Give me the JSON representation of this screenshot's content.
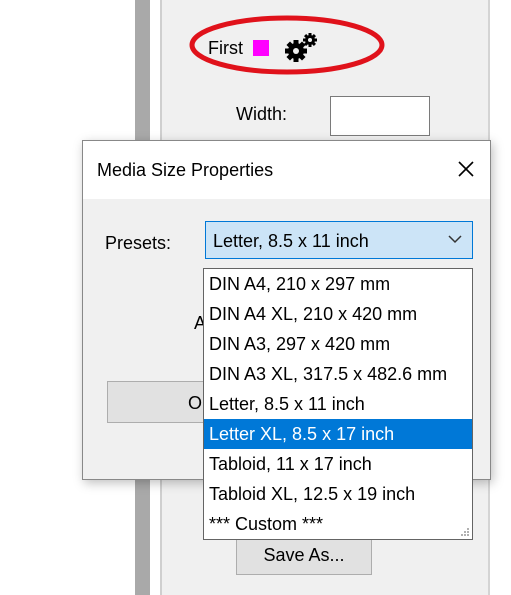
{
  "settings": {
    "first_label": "First",
    "first_color": "#ff00ff",
    "width_label": "Width:",
    "save_as_label": "Save As..."
  },
  "dialog": {
    "title": "Media Size Properties",
    "presets_label": "Presets:",
    "presets_value": "Letter, 8.5 x 11 inch",
    "partial_label": "A",
    "ok_label": "OK",
    "options": [
      "DIN A4, 210 x 297 mm",
      "DIN A4 XL, 210 x 420 mm",
      "DIN A3, 297 x 420 mm",
      "DIN A3 XL, 317.5 x 482.6 mm",
      "Letter, 8.5 x 11 inch",
      "Letter XL, 8.5 x 17 inch",
      "Tabloid, 11 x 17 inch",
      "Tabloid XL, 12.5 x 19 inch",
      "*** Custom ***"
    ],
    "highlighted_option": "Letter XL, 8.5 x 17 inch"
  },
  "colors": {
    "accent": "#0078d7",
    "annotation": "#e0121b",
    "swatch": "#ff00ff"
  },
  "icons": {
    "settings": "gears-icon",
    "close": "close-icon",
    "dropdown": "chevron-down-icon"
  }
}
